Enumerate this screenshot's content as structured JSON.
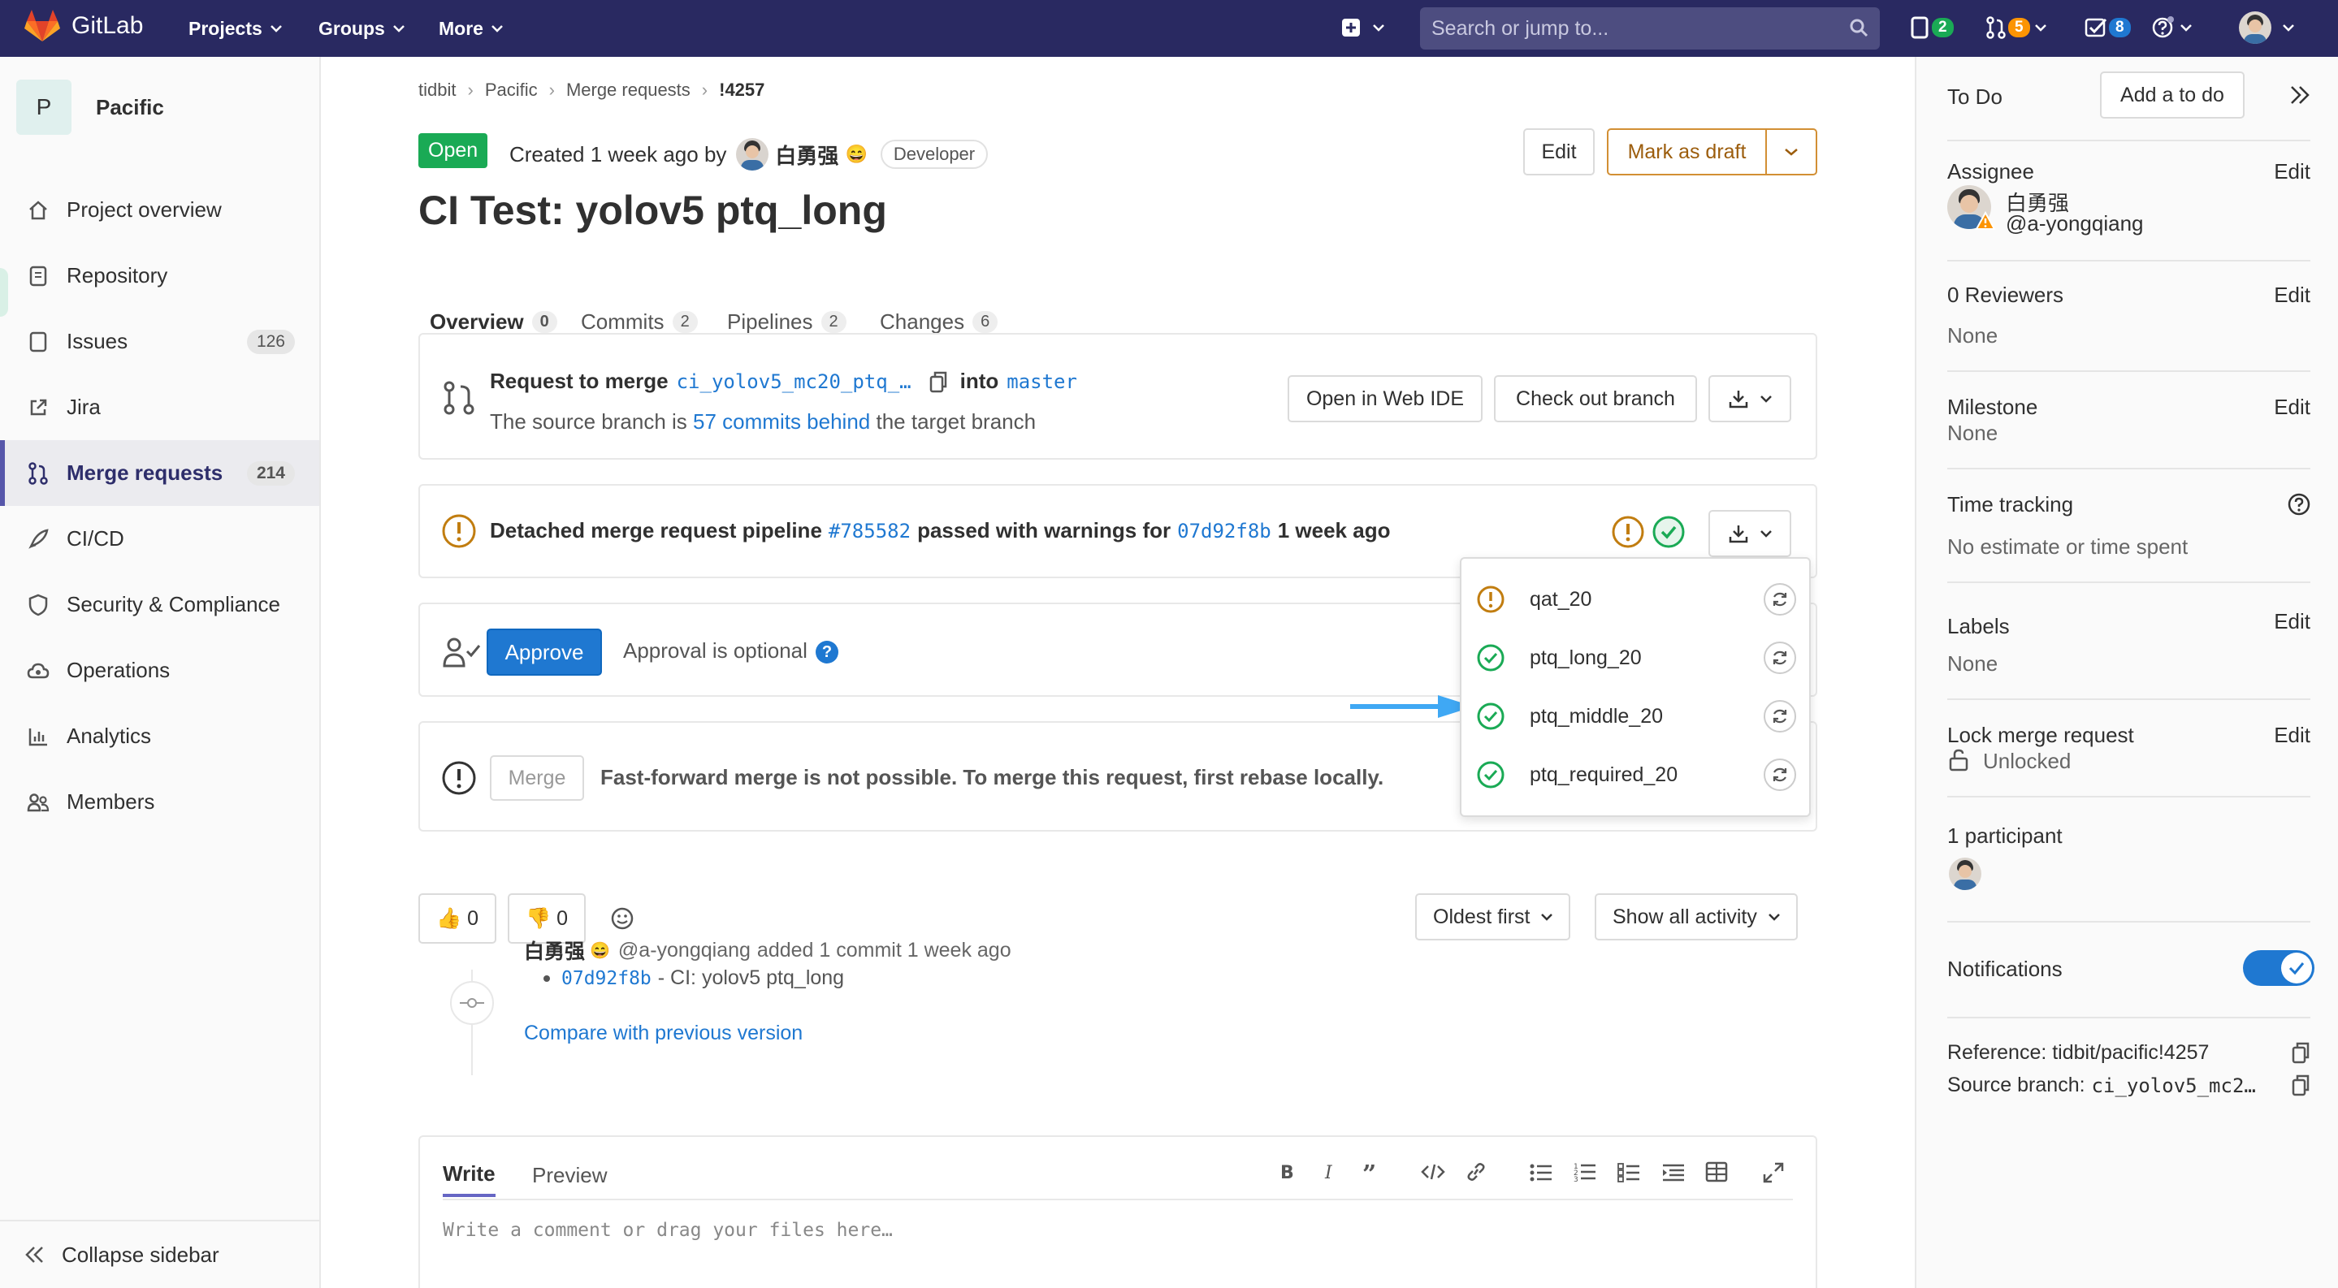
{
  "nav": {
    "brand": "GitLab",
    "projects": "Projects",
    "groups": "Groups",
    "more": "More",
    "search_placeholder": "Search or jump to...",
    "issues_count": "2",
    "mr_count": "5",
    "todo_count": "8",
    "brand_color": "#292961"
  },
  "sidebar": {
    "project_initial": "P",
    "project_name": "Pacific",
    "items": [
      {
        "label": "Project overview",
        "icon": "home-icon"
      },
      {
        "label": "Repository",
        "icon": "doc-icon"
      },
      {
        "label": "Issues",
        "icon": "issues-icon",
        "count": "126"
      },
      {
        "label": "Jira",
        "icon": "external-link-icon"
      },
      {
        "label": "Merge requests",
        "icon": "merge-request-icon",
        "count": "214",
        "active": true
      },
      {
        "label": "CI/CD",
        "icon": "rocket-icon"
      },
      {
        "label": "Security & Compliance",
        "icon": "shield-icon"
      },
      {
        "label": "Operations",
        "icon": "cloud-gear-icon"
      },
      {
        "label": "Analytics",
        "icon": "chart-icon"
      },
      {
        "label": "Members",
        "icon": "users-icon"
      }
    ],
    "collapse": "Collapse sidebar"
  },
  "breadcrumb": [
    "tidbit",
    "Pacific",
    "Merge requests",
    "!4257"
  ],
  "mr": {
    "status": "Open",
    "created_prefix": "Created",
    "created_time": "1 week ago",
    "by": "by",
    "author": "白勇强",
    "role": "Developer",
    "title": "CI Test: yolov5 ptq_long",
    "edit": "Edit",
    "mark_draft": "Mark as draft"
  },
  "tabs": [
    {
      "label": "Overview",
      "count": "0"
    },
    {
      "label": "Commits",
      "count": "2"
    },
    {
      "label": "Pipelines",
      "count": "2"
    },
    {
      "label": "Changes",
      "count": "6"
    }
  ],
  "merge_info": {
    "request_to_merge": "Request to merge",
    "source_branch": "ci_yolov5_mc20_ptq_…",
    "into": "into",
    "target_branch": "master",
    "behind_prefix": "The source branch is",
    "behind_link": "57 commits behind",
    "behind_suffix": "the target branch",
    "open_web_ide": "Open in Web IDE",
    "check_out": "Check out branch"
  },
  "pipeline": {
    "prefix": "Detached merge request pipeline",
    "id": "#785582",
    "middle": "passed with warnings for",
    "sha": "07d92f8b",
    "time": "1 week ago"
  },
  "stages": [
    {
      "name": "qat_20",
      "status": "warning"
    },
    {
      "name": "ptq_long_20",
      "status": "success"
    },
    {
      "name": "ptq_middle_20",
      "status": "success"
    },
    {
      "name": "ptq_required_20",
      "status": "success"
    }
  ],
  "approval": {
    "button": "Approve",
    "text": "Approval is optional",
    "help": "?"
  },
  "merge_box": {
    "button": "Merge",
    "text": "Fast-forward merge is not possible. To merge this request, first rebase locally."
  },
  "reactions": {
    "thumbs_up": "👍",
    "up_count": "0",
    "thumbs_down": "👎",
    "down_count": "0"
  },
  "sort": {
    "order": "Oldest first",
    "filter": "Show all activity"
  },
  "activity": {
    "author": "白勇强",
    "handle": "@a-yongqiang",
    "action": "added 1 commit 1 week ago",
    "commit_sha": "07d92f8b",
    "commit_msg": "- CI: yolov5 ptq_long",
    "compare": "Compare with previous version"
  },
  "editor": {
    "write": "Write",
    "preview": "Preview",
    "placeholder": "Write a comment or drag your files here…"
  },
  "right": {
    "todo": "To Do",
    "add_todo": "Add a to do",
    "assignee": "Assignee",
    "edit": "Edit",
    "assignee_name": "白勇强",
    "assignee_handle": "@a-yongqiang",
    "reviewers": "0 Reviewers",
    "none": "None",
    "milestone": "Milestone",
    "time_tracking": "Time tracking",
    "no_estimate": "No estimate or time spent",
    "labels": "Labels",
    "lock": "Lock merge request",
    "unlocked": "Unlocked",
    "participants": "1 participant",
    "notifications": "Notifications",
    "notifications_on": true,
    "reference": "Reference: tidbit/pacific!4257",
    "source_branch_label": "Source branch:",
    "source_branch": "ci_yolov5_mc2…"
  }
}
